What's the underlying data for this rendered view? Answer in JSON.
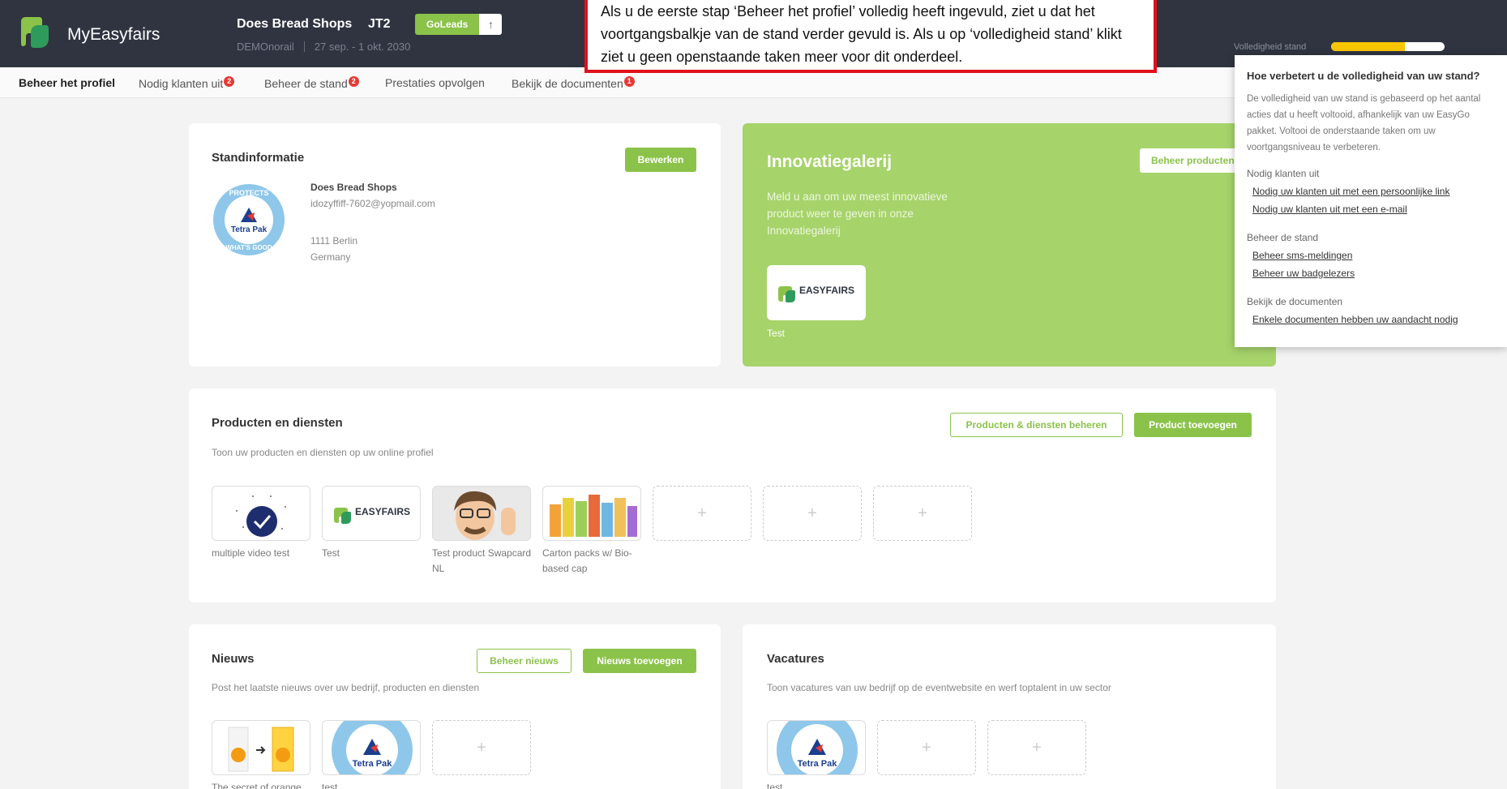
{
  "header": {
    "app_name": "MyEasyfairs",
    "company": "Does Bread Shops",
    "code": "JT2",
    "event": "DEMOnorail",
    "dates": "27 sep. - 1 okt. 2030",
    "goleads_label": "GoLeads",
    "goleads_icon": "arrow-up-icon",
    "completeness_label": "Volledigheid stand",
    "completeness_value": 0.65,
    "progress_color": "#f7c600",
    "brand_color": "#8bc34a",
    "topbar_color": "#2f3440"
  },
  "nav": {
    "items": [
      {
        "label": "Beheer het profiel",
        "badge": null
      },
      {
        "label": "Nodig klanten uit",
        "badge": "2"
      },
      {
        "label": "Beheer de stand",
        "badge": "2"
      },
      {
        "label": "Prestaties opvolgen",
        "badge": null
      },
      {
        "label": "Bekijk de documenten",
        "badge": "1"
      }
    ]
  },
  "callout": {
    "text": "Als u de eerste stap ‘Beheer het profiel’ volledig heeft ingevuld, ziet u dat het voortgangsbalkje van de stand verder gevuld is. Als u op ‘volledigheid stand’ klikt ziet u geen openstaande taken meer voor dit onderdeel."
  },
  "stand_info": {
    "title": "Standinformatie",
    "edit_label": "Bewerken",
    "company": "Does Bread Shops",
    "email": "idozyffiff-7602@yopmail.com",
    "city": "1111 Berlin",
    "country": "Germany",
    "logo_text_top": "PROTECTS",
    "logo_text_bottom": "WHAT'S GOOD",
    "logo_brand": "Tetra Pak"
  },
  "innovation": {
    "title": "Innovatiegalerij",
    "text": "Meld u aan om uw meest innovatieve product weer te geven in onze Innovatiegalerij",
    "button": "Beheer producten",
    "item_label": "Test",
    "logo_word": "EASYFAIRS"
  },
  "products": {
    "title": "Producten en diensten",
    "subtitle": "Toon uw producten en diensten op uw online profiel",
    "manage_label": "Producten & diensten beheren",
    "add_label": "Product toevoegen",
    "items": [
      {
        "label": "multiple video test"
      },
      {
        "label": "Test"
      },
      {
        "label": "Test product Swapcard NL"
      },
      {
        "label": "Carton packs w/ Bio-based cap"
      }
    ],
    "empty_symbol": "+"
  },
  "news": {
    "title": "Nieuws",
    "subtitle": "Post het laatste nieuws over uw bedrijf, producten en diensten",
    "manage_label": "Beheer nieuws",
    "add_label": "Nieuws toevoegen",
    "items": [
      {
        "label": "The secret of orange"
      },
      {
        "label": "test"
      }
    ]
  },
  "vacancies": {
    "title": "Vacatures",
    "subtitle": "Toon vacatures van uw bedrijf op de eventwebsite en werf toptalent in uw sector",
    "items": [
      {
        "label": "test"
      }
    ]
  },
  "popover": {
    "title": "Hoe verbetert u de volledigheid van uw stand?",
    "description": "De volledigheid van uw stand is gebaseerd op het aantal acties dat u heeft voltooid, afhankelijk van uw EasyGo pakket. Voltooi de onderstaande taken om uw voortgangsniveau te verbeteren.",
    "sections": [
      {
        "title": "Nodig klanten uit",
        "links": [
          "Nodig uw klanten uit met een persoonlijke link",
          "Nodig uw klanten uit met een e-mail"
        ]
      },
      {
        "title": "Beheer de stand",
        "links": [
          "Beheer sms-meldingen",
          "Beheer uw badgelezers"
        ]
      },
      {
        "title": "Bekijk de documenten",
        "links": [
          "Enkele documenten hebben uw aandacht nodig"
        ]
      }
    ]
  }
}
